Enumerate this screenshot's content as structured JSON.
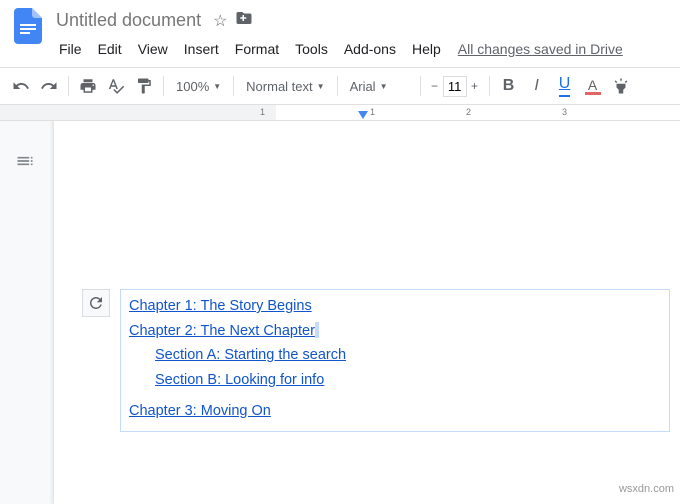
{
  "header": {
    "doc_title": "Untitled document",
    "save_status": "All changes saved in Drive",
    "menus": [
      "File",
      "Edit",
      "View",
      "Insert",
      "Format",
      "Tools",
      "Add-ons",
      "Help"
    ]
  },
  "toolbar": {
    "zoom": "100%",
    "style": "Normal text",
    "font": "Arial",
    "font_size": "11",
    "bold": "B",
    "italic": "I",
    "underline": "U",
    "text_color_letter": "A"
  },
  "ruler": {
    "marks": [
      "1",
      "1",
      "2",
      "3"
    ]
  },
  "toc": {
    "items": [
      {
        "text": "Chapter 1: The Story Begins",
        "level": 0
      },
      {
        "text": "Chapter 2: The Next Chapter",
        "level": 0,
        "cursor": true
      },
      {
        "text": "Section A: Starting the search",
        "level": 1
      },
      {
        "text": "Section B: Looking for info",
        "level": 1
      },
      {
        "text": "Chapter 3: Moving On",
        "level": 0
      }
    ]
  },
  "watermark": "wsxdn.com"
}
